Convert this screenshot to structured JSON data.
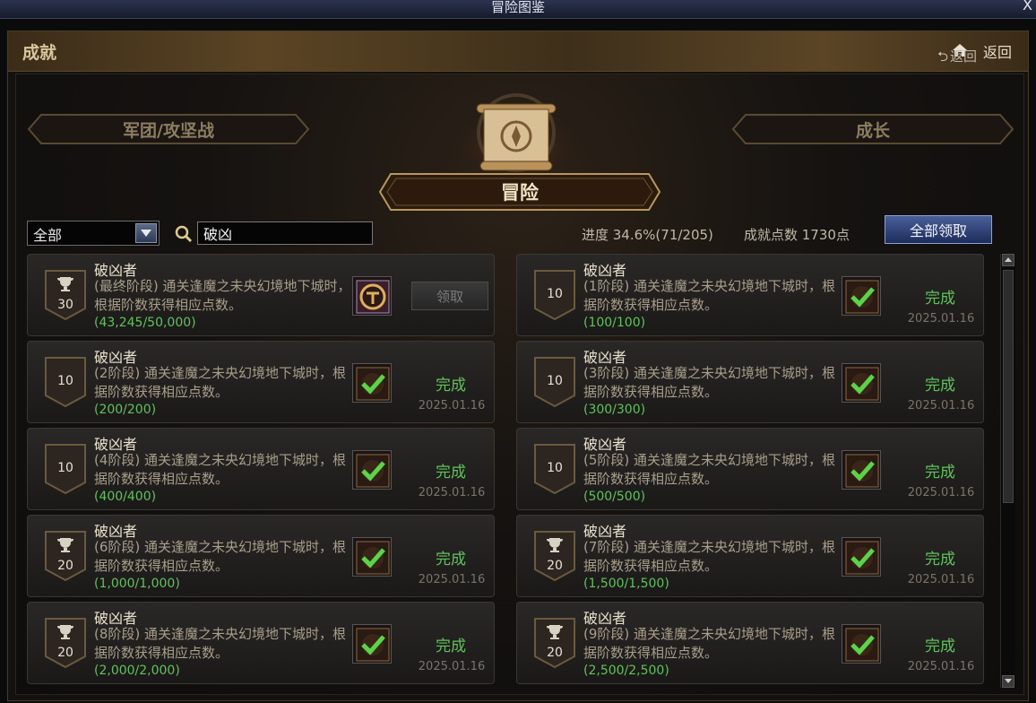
{
  "window": {
    "title": "冒险图鉴",
    "close_label": "X"
  },
  "header": {
    "title": "成就",
    "back_label": "返回"
  },
  "sub_back_label": "返回",
  "tabs": {
    "left": "军团/攻坚战",
    "center": "冒险",
    "right": "成长"
  },
  "filter": {
    "selected": "全部"
  },
  "search": {
    "value": "破凶"
  },
  "stats": {
    "progress": "进度 34.6%(71/205)",
    "points": "成就点数 1730点"
  },
  "claim_all_label": "全部领取",
  "achievements": [
    {
      "name": "破凶者",
      "desc": "(最终阶段) 通关逢魔之未央幻境地下城时，根据阶数获得相应点数。",
      "progress": "(43,245/50,000)",
      "points": "30",
      "trophy": true,
      "completed": false,
      "action": "领取",
      "date": ""
    },
    {
      "name": "破凶者",
      "desc": "(1阶段) 通关逢魔之未央幻境地下城时，根据阶数获得相应点数。",
      "progress": "(100/100)",
      "points": "10",
      "trophy": false,
      "completed": true,
      "status": "完成",
      "date": "2025.01.16"
    },
    {
      "name": "破凶者",
      "desc": "(2阶段) 通关逢魔之未央幻境地下城时，根据阶数获得相应点数。",
      "progress": "(200/200)",
      "points": "10",
      "trophy": false,
      "completed": true,
      "status": "完成",
      "date": "2025.01.16"
    },
    {
      "name": "破凶者",
      "desc": "(3阶段) 通关逢魔之未央幻境地下城时，根据阶数获得相应点数。",
      "progress": "(300/300)",
      "points": "10",
      "trophy": false,
      "completed": true,
      "status": "完成",
      "date": "2025.01.16"
    },
    {
      "name": "破凶者",
      "desc": "(4阶段) 通关逢魔之未央幻境地下城时，根据阶数获得相应点数。",
      "progress": "(400/400)",
      "points": "10",
      "trophy": false,
      "completed": true,
      "status": "完成",
      "date": "2025.01.16"
    },
    {
      "name": "破凶者",
      "desc": "(5阶段) 通关逢魔之未央幻境地下城时，根据阶数获得相应点数。",
      "progress": "(500/500)",
      "points": "10",
      "trophy": false,
      "completed": true,
      "status": "完成",
      "date": "2025.01.16"
    },
    {
      "name": "破凶者",
      "desc": "(6阶段) 通关逢魔之未央幻境地下城时，根据阶数获得相应点数。",
      "progress": "(1,000/1,000)",
      "points": "20",
      "trophy": true,
      "completed": true,
      "status": "完成",
      "date": "2025.01.16"
    },
    {
      "name": "破凶者",
      "desc": "(7阶段) 通关逢魔之未央幻境地下城时，根据阶数获得相应点数。",
      "progress": "(1,500/1,500)",
      "points": "20",
      "trophy": true,
      "completed": true,
      "status": "完成",
      "date": "2025.01.16"
    },
    {
      "name": "破凶者",
      "desc": "(8阶段) 通关逢魔之未央幻境地下城时，根据阶数获得相应点数。",
      "progress": "(2,000/2,000)",
      "points": "20",
      "trophy": true,
      "completed": true,
      "status": "完成",
      "date": "2025.01.16"
    },
    {
      "name": "破凶者",
      "desc": "(9阶段) 通关逢魔之未央幻境地下城时，根据阶数获得相应点数。",
      "progress": "(2,500/2,500)",
      "points": "20",
      "trophy": true,
      "completed": true,
      "status": "完成",
      "date": "2025.01.16"
    }
  ]
}
